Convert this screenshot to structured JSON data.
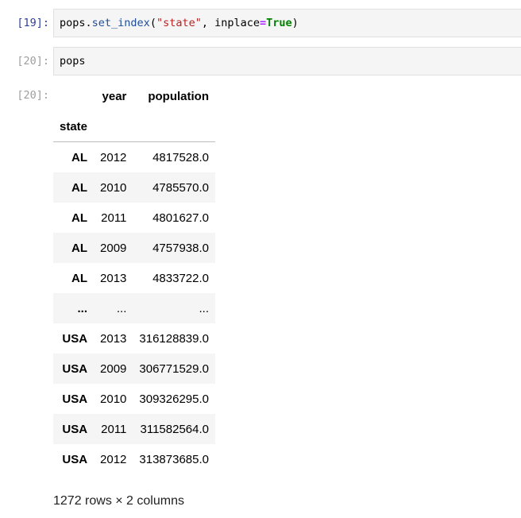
{
  "cells": [
    {
      "prompt": "[19]:",
      "code_tokens": [
        {
          "t": "pops",
          "c": "tok-var"
        },
        {
          "t": ".",
          "c": "tok-p"
        },
        {
          "t": "set_index",
          "c": "tok-fn"
        },
        {
          "t": "(",
          "c": "tok-p"
        },
        {
          "t": "\"state\"",
          "c": "tok-str"
        },
        {
          "t": ", inplace",
          "c": "tok-p"
        },
        {
          "t": "=",
          "c": "tok-op"
        },
        {
          "t": "True",
          "c": "tok-kw"
        },
        {
          "t": ")",
          "c": "tok-p"
        }
      ]
    },
    {
      "prompt": "[20]:",
      "code_tokens": [
        {
          "t": "pops",
          "c": "tok-var"
        }
      ]
    }
  ],
  "output": {
    "prompt": "[20]:",
    "columns": [
      "year",
      "population"
    ],
    "index_name": "state",
    "rows": [
      {
        "state": "AL",
        "year": "2012",
        "population": "4817528.0"
      },
      {
        "state": "AL",
        "year": "2010",
        "population": "4785570.0"
      },
      {
        "state": "AL",
        "year": "2011",
        "population": "4801627.0"
      },
      {
        "state": "AL",
        "year": "2009",
        "population": "4757938.0"
      },
      {
        "state": "AL",
        "year": "2013",
        "population": "4833722.0"
      },
      {
        "state": "...",
        "year": "...",
        "population": "..."
      },
      {
        "state": "USA",
        "year": "2013",
        "population": "316128839.0"
      },
      {
        "state": "USA",
        "year": "2009",
        "population": "306771529.0"
      },
      {
        "state": "USA",
        "year": "2010",
        "population": "309326295.0"
      },
      {
        "state": "USA",
        "year": "2011",
        "population": "311582564.0"
      },
      {
        "state": "USA",
        "year": "2012",
        "population": "313873685.0"
      }
    ],
    "summary": "1272 rows × 2 columns"
  }
}
